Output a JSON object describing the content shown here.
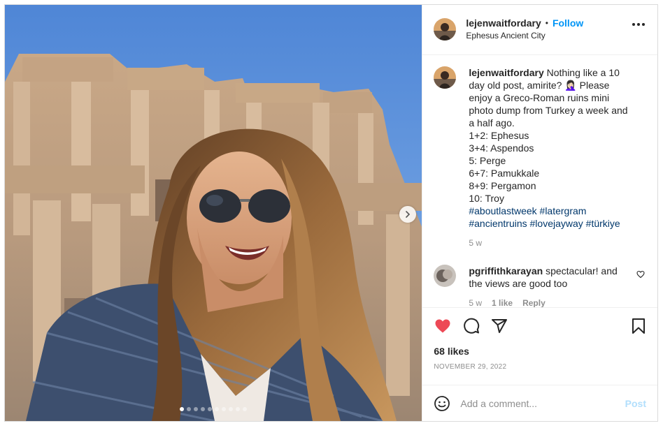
{
  "post": {
    "author": "lejenwaitfordary",
    "follow_label": "Follow",
    "separator": "•",
    "location": "Ephesus Ancient City",
    "more_icon": "more-horizontal-icon",
    "carousel": {
      "total_slides": 10,
      "current_slide": 1,
      "next_icon": "chevron-right-icon"
    }
  },
  "caption": {
    "username": "lejenwaitfordary",
    "lines": [
      "Nothing like a 10",
      "day old post, amirite? 🤦🏻‍♀️ Please",
      "enjoy a Greco-Roman ruins mini",
      "photo dump from Turkey a week and",
      "a half ago.",
      "1+2: Ephesus",
      "3+4: Aspendos",
      "5: Perge",
      "6+7: Pamukkale",
      "8+9: Pergamon",
      "10: Troy"
    ],
    "hashtags_line1": "#aboutlastweek #latergram",
    "hashtags_line2": "#ancientruins #lovejayway #türkiye",
    "time": "5 w"
  },
  "reply": {
    "username": "pgriffithkarayan",
    "text": "spectacular! and",
    "text2": "the views are good too",
    "time": "5 w",
    "likes": "1 like",
    "reply_label": "Reply"
  },
  "actions": {
    "likes": "68 likes",
    "date": "November 29, 2022",
    "like_color": "#ed4956"
  },
  "composer": {
    "placeholder": "Add a comment...",
    "post_label": "Post",
    "emoji_icon": "emoji-icon"
  }
}
